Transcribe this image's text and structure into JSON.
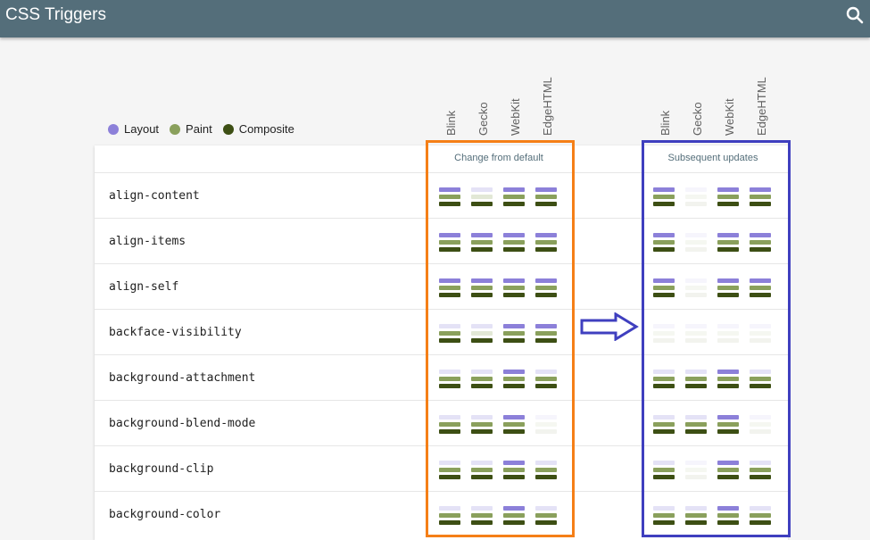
{
  "app": {
    "title": "CSS Triggers"
  },
  "icons": {
    "search": "search-icon",
    "arrow": "right-arrow-icon"
  },
  "colors": {
    "layout": "#8c80d9",
    "paint": "#8aa05c",
    "composite": "#3d4f14",
    "inactive_layout": "#e4e2f6",
    "inactive_paint": "#e2e8d6",
    "inactive_composite": "#d9dccf",
    "highlight_orange": "#f57f17",
    "highlight_blue": "#3f3fbf",
    "header": "#546e7a"
  },
  "legend": [
    {
      "label": "Layout",
      "color": "#8c80d9"
    },
    {
      "label": "Paint",
      "color": "#8aa05c"
    },
    {
      "label": "Composite",
      "color": "#3d4f14"
    }
  ],
  "engines": [
    "Blink",
    "Gecko",
    "WebKit",
    "EdgeHTML"
  ],
  "groups": [
    "Change from default",
    "Subsequent updates"
  ],
  "properties": [
    {
      "name": "align-content",
      "change": [
        "LPC",
        "pC",
        "LPC",
        "LPC"
      ],
      "subsequent": [
        "LPC",
        "",
        "LPC",
        "LPC"
      ]
    },
    {
      "name": "align-items",
      "change": [
        "LPC",
        "LPC",
        "LPC",
        "LPC"
      ],
      "subsequent": [
        "LPC",
        "",
        "LPC",
        "LPC"
      ]
    },
    {
      "name": "align-self",
      "change": [
        "LPC",
        "LPC",
        "LPC",
        "LPC"
      ],
      "subsequent": [
        "LPC",
        "",
        "LPC",
        "LPC"
      ]
    },
    {
      "name": "backface-visibility",
      "change": [
        "PC",
        "C",
        "LPC",
        "LPC"
      ],
      "subsequent": [
        "",
        "",
        "",
        ""
      ]
    },
    {
      "name": "background-attachment",
      "change": [
        "PC",
        "PC",
        "LPC",
        "PC"
      ],
      "subsequent": [
        "PC",
        "PC",
        "LPC",
        "PC"
      ]
    },
    {
      "name": "background-blend-mode",
      "change": [
        "PC",
        "PC",
        "LPC",
        ""
      ],
      "subsequent": [
        "PC",
        "PC",
        "LPC",
        ""
      ]
    },
    {
      "name": "background-clip",
      "change": [
        "PC",
        "PC",
        "LPC",
        "PC"
      ],
      "subsequent": [
        "PC",
        "",
        "LPC",
        "PC"
      ]
    },
    {
      "name": "background-color",
      "change": [
        "PC",
        "PC",
        "LPC",
        "PC"
      ],
      "subsequent": [
        "PC",
        "PC",
        "LPC",
        "PC"
      ]
    }
  ]
}
